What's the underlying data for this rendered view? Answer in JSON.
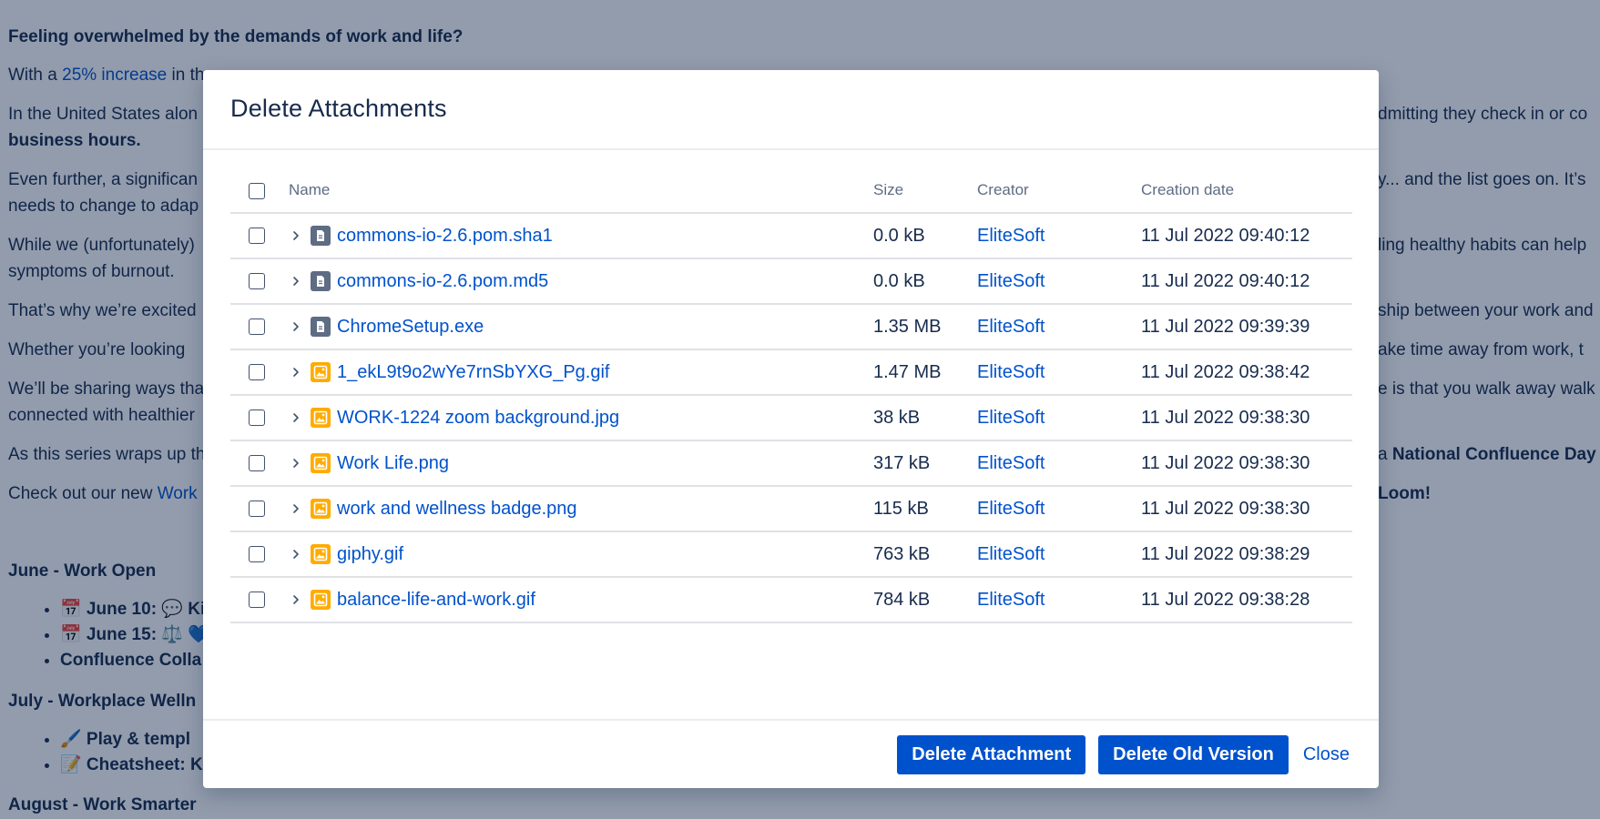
{
  "background": {
    "heading": "Feeling overwhelmed by the demands of work and life?",
    "p1_prefix": "With a ",
    "p1_link": "25% increase",
    "p1_rest": " in th",
    "p2_left": "In the United States alon",
    "p2_right": "dmitting they check in or co",
    "p2_bold": "business hours.",
    "p3_left": "Even further, a significan",
    "p3_right": "y... and the list goes on. It’s",
    "p3_line2": "needs to change to adap",
    "p4_left": "While we (unfortunately)",
    "p4_right": "ling healthy habits can help",
    "p4_line2": "symptoms of burnout.",
    "p5_left": "That’s why we’re excited",
    "p5_right": "ship between your work and",
    "p6_left": "Whether you’re looking",
    "p6_right": "ake time away from work, t",
    "p7_left": "We’ll be sharing ways tha",
    "p7_right": "e is that you walk away walk",
    "p7_line2": "connected with healthier",
    "p8_left": "As this series wraps up th",
    "p8_right_prefix": "a ",
    "p8_right_bold": "National Confluence Day",
    "p9_left": "Check out our new ",
    "p9_link": "Work",
    "p9_right": "Loom!",
    "june_heading": "June - Work Open",
    "june_items": [
      "📅 June 10: 💬 Ki",
      "📅 June 15: ⚖️ 💙",
      "Confluence Colla"
    ],
    "july_heading": "July - Workplace Welln",
    "july_items": [
      "🖌️ Play & templ",
      "📝 Cheatsheet: K"
    ],
    "august_heading": "August - Work Smarter"
  },
  "modal": {
    "title": "Delete Attachments",
    "columns": {
      "name": "Name",
      "size": "Size",
      "creator": "Creator",
      "date": "Creation date"
    },
    "rows": [
      {
        "name": "commons-io-2.6.pom.sha1",
        "icon": "document-icon",
        "size": "0.0 kB",
        "creator": "EliteSoft",
        "date": "11 Jul 2022 09:40:12"
      },
      {
        "name": "commons-io-2.6.pom.md5",
        "icon": "document-icon",
        "size": "0.0 kB",
        "creator": "EliteSoft",
        "date": "11 Jul 2022 09:40:12"
      },
      {
        "name": "ChromeSetup.exe",
        "icon": "document-icon",
        "size": "1.35 MB",
        "creator": "EliteSoft",
        "date": "11 Jul 2022 09:39:39"
      },
      {
        "name": "1_ekL9t9o2wYe7rnSbYXG_Pg.gif",
        "icon": "image-icon",
        "size": "1.47 MB",
        "creator": "EliteSoft",
        "date": "11 Jul 2022 09:38:42"
      },
      {
        "name": "WORK-1224 zoom background.jpg",
        "icon": "image-icon",
        "size": "38 kB",
        "creator": "EliteSoft",
        "date": "11 Jul 2022 09:38:30"
      },
      {
        "name": "Work Life.png",
        "icon": "image-icon",
        "size": "317 kB",
        "creator": "EliteSoft",
        "date": "11 Jul 2022 09:38:30"
      },
      {
        "name": "work and wellness badge.png",
        "icon": "image-icon",
        "size": "115 kB",
        "creator": "EliteSoft",
        "date": "11 Jul 2022 09:38:30"
      },
      {
        "name": "giphy.gif",
        "icon": "image-icon",
        "size": "763 kB",
        "creator": "EliteSoft",
        "date": "11 Jul 2022 09:38:29"
      },
      {
        "name": "balance-life-and-work.gif",
        "icon": "image-icon",
        "size": "784 kB",
        "creator": "EliteSoft",
        "date": "11 Jul 2022 09:38:28"
      }
    ],
    "buttons": {
      "delete_attachment": "Delete Attachment",
      "delete_old_version": "Delete Old Version",
      "close": "Close"
    }
  },
  "colors": {
    "primary": "#0052cc",
    "overlay": "rgba(9,30,66,0.44)",
    "image_icon": "#ffab00",
    "doc_icon": "#5e6c84"
  }
}
